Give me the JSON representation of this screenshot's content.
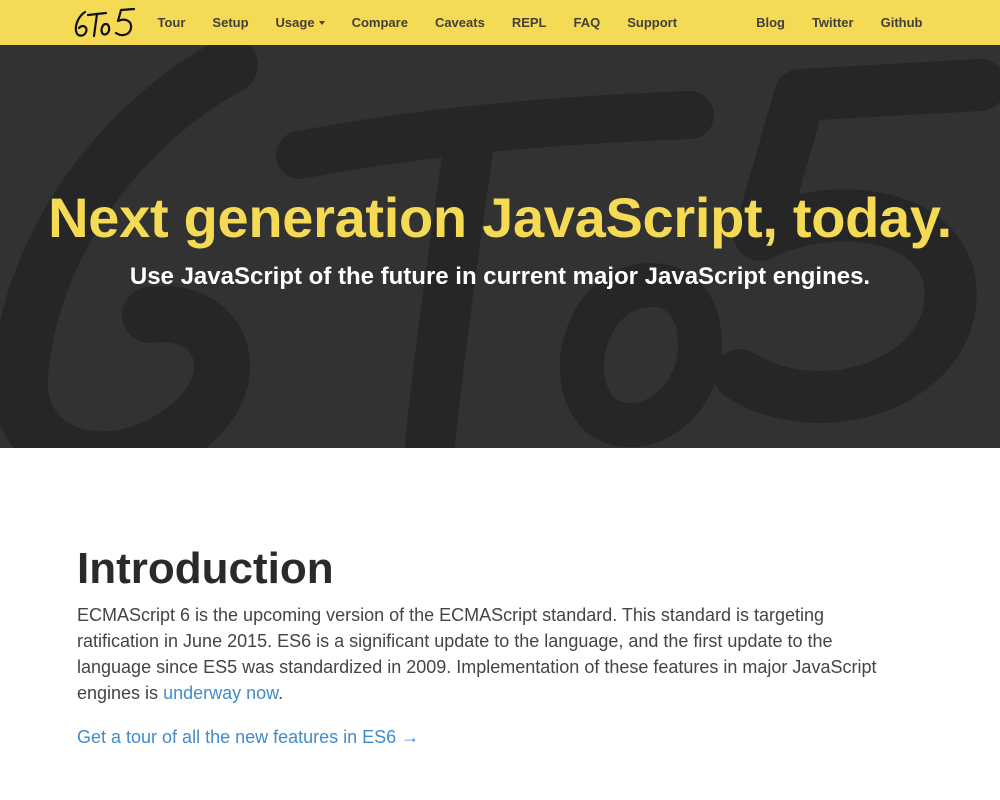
{
  "navbar": {
    "brand": "6to5",
    "left_links": [
      "Tour",
      "Setup",
      "Usage",
      "Compare",
      "Caveats",
      "REPL",
      "FAQ",
      "Support"
    ],
    "usage_has_dropdown": true,
    "right_links": [
      "Blog",
      "Twitter",
      "Github"
    ],
    "background_color": "#f5da55"
  },
  "hero": {
    "title": "Next generation JavaScript, today.",
    "subtitle": "Use JavaScript of the future in current major JavaScript engines.",
    "title_color": "#f5da55",
    "background_color": "#323232"
  },
  "introduction": {
    "heading": "Introduction",
    "paragraph_text": "ECMAScript 6 is the upcoming version of the ECMAScript standard. This standard is targeting ratification in June 2015. ES6 is a significant update to the language, and the first update to the language since ES5 was standardized in 2009. Implementation of these features in major JavaScript engines is ",
    "paragraph_link": "underway now",
    "paragraph_end": ".",
    "tour_link": "Get a tour of all the new features in ES6 →",
    "link_color": "#428bca"
  }
}
